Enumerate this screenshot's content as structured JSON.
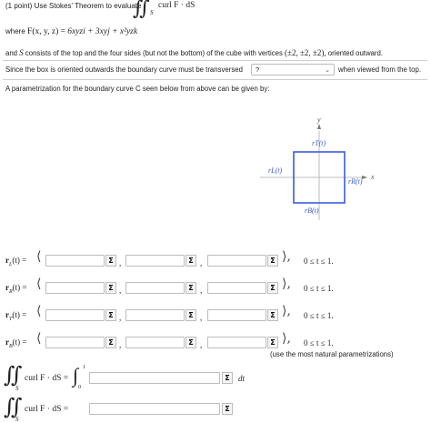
{
  "header": {
    "prefix": "(1 point) Use Stokes' Theorem to evaluate",
    "integral_sub": "S",
    "integrand": "curl F · dS"
  },
  "field": {
    "where": "where",
    "F_lhs": "F(x, y, z) =",
    "F_rhs": "6xyzi + 3xyj + x²yzk"
  },
  "surface": {
    "text_a": "and",
    "text_S": "S",
    "text_b": "consists of the top and the four sides (but not the bottom) of the cube with vertices",
    "vertices": "(±2, ±2, ±2),",
    "text_c": "oriented outward."
  },
  "orientation_row": {
    "before": "Since the box is oriented outwards the boundary curve must be transversed",
    "select_value": "?",
    "after": "when viewed from the top."
  },
  "param_intro": "A parametrization for the boundary curve C seen below from above can be given by:",
  "diagram": {
    "y_axis": "y",
    "x_axis": "x",
    "top_label": "rT(t)",
    "left_label": "rL(t)",
    "right_label": "rR(t)",
    "bottom_label": "rB(t)",
    "square_color": "#3b5bdb",
    "label_color": "#3b5bdb"
  },
  "rows": [
    {
      "label_r": "r",
      "label_sub": "L",
      "label_rest": "(t) =",
      "range": "0 ≤ t ≤ 1."
    },
    {
      "label_r": "r",
      "label_sub": "R",
      "label_rest": "(t) =",
      "range": "0 ≤ t ≤ 1."
    },
    {
      "label_r": "r",
      "label_sub": "T",
      "label_rest": "(t) =",
      "range": "0 ≤ t ≤ 1."
    },
    {
      "label_r": "r",
      "label_sub": "B",
      "label_rest": "(t) =",
      "range": "0 ≤ t ≤ 1."
    }
  ],
  "sigma_symbol": "Σ",
  "note": "(use the most natural parametrizations)",
  "integral1": {
    "lhs": "curl F · dS =",
    "upper": "1",
    "lower": "0",
    "dt": "dt"
  },
  "integral2": {
    "lhs": "curl F · dS ="
  }
}
